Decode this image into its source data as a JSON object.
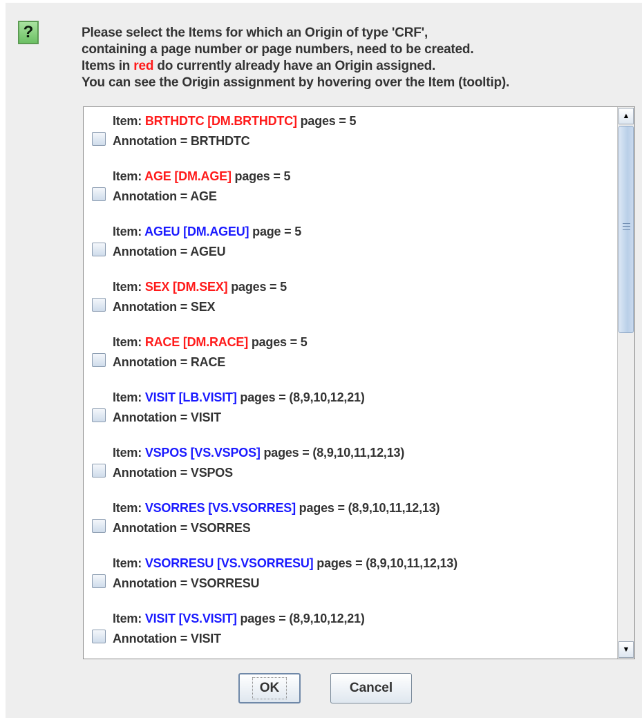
{
  "dialog": {
    "message_lines": [
      "Please select the Items for which an Origin of type 'CRF',",
      "containing a page number or page numbers, need to be created.",
      "Items in ",
      "red",
      " do currently already have an Origin assigned.",
      "You can see the Origin assignment by hovering over the Item (tooltip)."
    ],
    "icon_glyph": "?",
    "ok_label": "OK",
    "cancel_label": "Cancel"
  },
  "items": [
    {
      "prefix": "Item: ",
      "name": "BRTHDTC [DM.BRTHDTC]",
      "suffix": " pages = 5",
      "annotation": "Annotation = BRTHDTC",
      "color": "red",
      "checked": false
    },
    {
      "prefix": "Item: ",
      "name": "AGE [DM.AGE]",
      "suffix": " pages = 5",
      "annotation": "Annotation = AGE",
      "color": "red",
      "checked": false
    },
    {
      "prefix": "Item: ",
      "name": "AGEU [DM.AGEU]",
      "suffix": " page = 5",
      "annotation": "Annotation = AGEU",
      "color": "blue",
      "checked": false
    },
    {
      "prefix": "Item: ",
      "name": "SEX [DM.SEX]",
      "suffix": " pages = 5",
      "annotation": "Annotation = SEX",
      "color": "red",
      "checked": false
    },
    {
      "prefix": "Item: ",
      "name": "RACE [DM.RACE]",
      "suffix": " pages = 5",
      "annotation": "Annotation = RACE",
      "color": "red",
      "checked": false
    },
    {
      "prefix": "Item: ",
      "name": "VISIT [LB.VISIT]",
      "suffix": " pages = (8,9,10,12,21)",
      "annotation": "Annotation = VISIT",
      "color": "blue",
      "checked": false
    },
    {
      "prefix": "Item: ",
      "name": "VSPOS [VS.VSPOS]",
      "suffix": " pages = (8,9,10,11,12,13)",
      "annotation": "Annotation = VSPOS",
      "color": "blue",
      "checked": false
    },
    {
      "prefix": "Item: ",
      "name": "VSORRES [VS.VSORRES]",
      "suffix": " pages = (8,9,10,11,12,13)",
      "annotation": "Annotation = VSORRES",
      "color": "blue",
      "checked": false
    },
    {
      "prefix": "Item: ",
      "name": "VSORRESU [VS.VSORRESU]",
      "suffix": " pages = (8,9,10,11,12,13)",
      "annotation": "Annotation = VSORRESU",
      "color": "blue",
      "checked": false
    },
    {
      "prefix": "Item: ",
      "name": "VISIT [VS.VISIT]",
      "suffix": " pages = (8,9,10,12,21)",
      "annotation": "Annotation = VISIT",
      "color": "blue",
      "checked": false
    }
  ],
  "colors": {
    "red": "#ff1a1a",
    "blue": "#1a1aff",
    "text": "#333333"
  }
}
